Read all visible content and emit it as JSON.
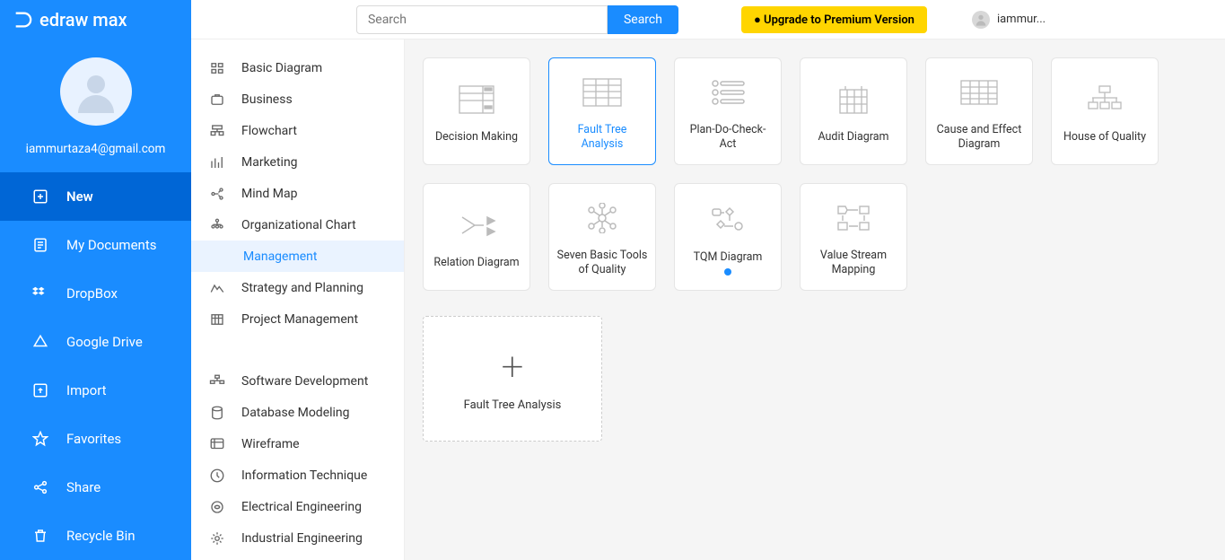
{
  "app": {
    "name": "edraw max"
  },
  "topbar": {
    "search_placeholder": "Search",
    "search_button": "Search",
    "upgrade_label": "● Upgrade to Premium Version",
    "user_display": "iammur..."
  },
  "profile": {
    "email": "iammurtaza4@gmail.com"
  },
  "nav": {
    "new": "New",
    "mydocs": "My Documents",
    "dropbox": "DropBox",
    "gdrive": "Google Drive",
    "import": "Import",
    "favorites": "Favorites",
    "share": "Share",
    "recycle": "Recycle Bin"
  },
  "categories": {
    "group1": [
      "Basic Diagram",
      "Business",
      "Flowchart",
      "Marketing",
      "Mind Map",
      "Organizational Chart",
      "Management",
      "Strategy and Planning",
      "Project Management"
    ],
    "group2": [
      "Software Development",
      "Database Modeling",
      "Wireframe",
      "Information Technique",
      "Electrical Engineering",
      "Industrial Engineering"
    ],
    "selected": "Management"
  },
  "templates": {
    "row1": [
      {
        "label": "Decision Making",
        "selected": false,
        "dot": false
      },
      {
        "label": "Fault Tree Analysis",
        "selected": true,
        "dot": false
      },
      {
        "label": "Plan-Do-Check-Act",
        "selected": false,
        "dot": false
      },
      {
        "label": "Audit Diagram",
        "selected": false,
        "dot": false
      },
      {
        "label": "Cause and Effect Diagram",
        "selected": false,
        "dot": false
      },
      {
        "label": "House of Quality",
        "selected": false,
        "dot": false
      }
    ],
    "row2": [
      {
        "label": "Relation Diagram",
        "selected": false,
        "dot": false
      },
      {
        "label": "Seven Basic Tools of Quality",
        "selected": false,
        "dot": false
      },
      {
        "label": "TQM Diagram",
        "selected": false,
        "dot": true
      },
      {
        "label": "Value Stream Mapping",
        "selected": false,
        "dot": false
      }
    ]
  },
  "newcard": {
    "label": "Fault Tree Analysis"
  }
}
